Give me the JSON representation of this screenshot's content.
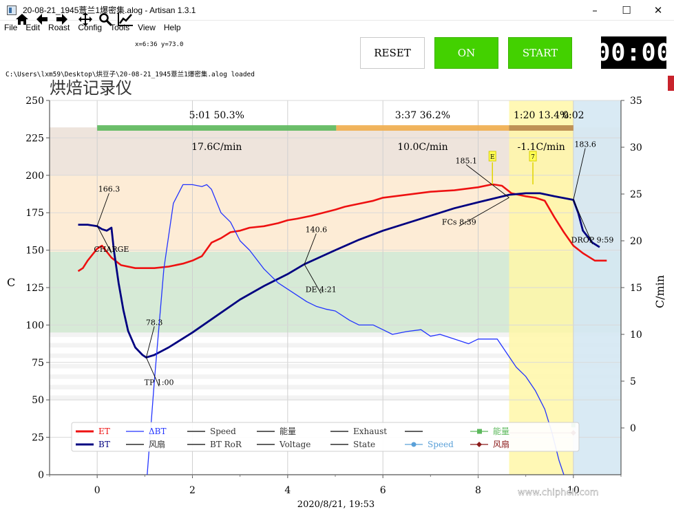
{
  "window": {
    "title": "20-08-21_1945薏兰1爆密集.alog - Artisan 1.3.1",
    "controls": [
      "–",
      "☐",
      "✕"
    ]
  },
  "menu": [
    "File",
    "Edit",
    "Roast",
    "Config",
    "Tools",
    "View",
    "Help"
  ],
  "toolbar": {
    "icons": [
      "home-icon",
      "back-arrow-icon",
      "forward-arrow-icon",
      "pan-icon",
      "zoom-icon",
      "chart-icon"
    ],
    "coordinate_readout": "x=6:36 y=73.0"
  },
  "buttons": {
    "reset": "RESET",
    "on": "ON",
    "start": "START"
  },
  "timer": "00:00",
  "status_message": "C:\\Users\\lxm59\\Desktop\\烘豆子\\20-08-21_1945薏兰1爆密集.alog  loaded",
  "colors": {
    "et": "#ee1111",
    "bt": "#000080",
    "delta_bt": "#2233ff",
    "phase_drying": "#5cb85c",
    "phase_maillard": "#f0ad4e",
    "phase_development": "#b8864b",
    "button_green": "#43d100"
  },
  "chart_data": {
    "type": "line",
    "title": "烘焙记录仪",
    "xlabel": "2020/8/21, 19:53",
    "ylabel": "C",
    "y2label": "C/min",
    "xlim": [
      -1,
      11
    ],
    "ylim": [
      0,
      250
    ],
    "y2lim": [
      -5,
      35
    ],
    "xticks": [
      0,
      2,
      4,
      6,
      8,
      10
    ],
    "yticks": [
      0,
      25,
      50,
      75,
      100,
      125,
      150,
      175,
      200,
      225,
      250
    ],
    "y2ticks": [
      0,
      5,
      10,
      15,
      20,
      25,
      30,
      35
    ],
    "grid": true,
    "phases": [
      {
        "time": "5:01",
        "pct": "50.3%",
        "ror": "17.6C/min",
        "start": 0,
        "end": 5.02
      },
      {
        "time": "3:37",
        "pct": "36.2%",
        "ror": "10.0C/min",
        "start": 5.02,
        "end": 8.65
      },
      {
        "time": "1:20",
        "pct": "13.4%",
        "ror": "-1.1C/min",
        "start": 8.65,
        "end": 10.0
      }
    ],
    "phase_extra_label": "0:02",
    "series": [
      {
        "name": "ET",
        "axis": "left",
        "points": [
          [
            -0.4,
            136
          ],
          [
            -0.3,
            138
          ],
          [
            -0.2,
            143
          ],
          [
            -0.1,
            147
          ],
          [
            0.0,
            151
          ],
          [
            0.1,
            153
          ],
          [
            0.3,
            145
          ],
          [
            0.5,
            140
          ],
          [
            0.8,
            138
          ],
          [
            1.2,
            138
          ],
          [
            1.5,
            139
          ],
          [
            1.8,
            141
          ],
          [
            2.0,
            143
          ],
          [
            2.2,
            146
          ],
          [
            2.4,
            155
          ],
          [
            2.6,
            158
          ],
          [
            2.8,
            162
          ],
          [
            3.0,
            163
          ],
          [
            3.2,
            165
          ],
          [
            3.5,
            166
          ],
          [
            3.8,
            168
          ],
          [
            4.0,
            170
          ],
          [
            4.2,
            171
          ],
          [
            4.5,
            173
          ],
          [
            5.0,
            177
          ],
          [
            5.2,
            179
          ],
          [
            5.5,
            181
          ],
          [
            5.8,
            183
          ],
          [
            6.0,
            185
          ],
          [
            6.5,
            187
          ],
          [
            7.0,
            189
          ],
          [
            7.5,
            190
          ],
          [
            8.0,
            192
          ],
          [
            8.3,
            194
          ],
          [
            8.5,
            193
          ],
          [
            8.7,
            188
          ],
          [
            9.0,
            186
          ],
          [
            9.2,
            185
          ],
          [
            9.4,
            183
          ],
          [
            9.6,
            172
          ],
          [
            9.8,
            162
          ],
          [
            10.0,
            153
          ],
          [
            10.2,
            148
          ],
          [
            10.3,
            146
          ],
          [
            10.45,
            143
          ],
          [
            10.7,
            143
          ]
        ]
      },
      {
        "name": "BT",
        "axis": "left",
        "points": [
          [
            -0.4,
            167
          ],
          [
            -0.2,
            167
          ],
          [
            0.0,
            166
          ],
          [
            0.1,
            164
          ],
          [
            0.2,
            163
          ],
          [
            0.3,
            165
          ],
          [
            0.35,
            150
          ],
          [
            0.45,
            128
          ],
          [
            0.55,
            110
          ],
          [
            0.65,
            96
          ],
          [
            0.8,
            85
          ],
          [
            0.95,
            80
          ],
          [
            1.03,
            78.3
          ],
          [
            1.2,
            80
          ],
          [
            1.5,
            85
          ],
          [
            2.0,
            95
          ],
          [
            2.5,
            106
          ],
          [
            3.0,
            117
          ],
          [
            3.5,
            126
          ],
          [
            4.0,
            134
          ],
          [
            4.35,
            140.6
          ],
          [
            5.0,
            150
          ],
          [
            5.5,
            157
          ],
          [
            6.0,
            163
          ],
          [
            6.5,
            168
          ],
          [
            7.0,
            173
          ],
          [
            7.5,
            178
          ],
          [
            8.0,
            182
          ],
          [
            8.65,
            187
          ],
          [
            9.0,
            188
          ],
          [
            9.3,
            188
          ],
          [
            9.6,
            186
          ],
          [
            10.0,
            183.6
          ],
          [
            10.1,
            175
          ],
          [
            10.2,
            163
          ],
          [
            10.4,
            155
          ],
          [
            10.55,
            152
          ]
        ]
      },
      {
        "name": "ΔBT",
        "axis": "right",
        "points": [
          [
            1.05,
            -5
          ],
          [
            1.2,
            5
          ],
          [
            1.4,
            17
          ],
          [
            1.6,
            24
          ],
          [
            1.8,
            26
          ],
          [
            2.0,
            26
          ],
          [
            2.2,
            25.8
          ],
          [
            2.3,
            26
          ],
          [
            2.4,
            25.5
          ],
          [
            2.6,
            23
          ],
          [
            2.8,
            22
          ],
          [
            3.0,
            20
          ],
          [
            3.2,
            19
          ],
          [
            3.5,
            17
          ],
          [
            3.8,
            15.5
          ],
          [
            4.1,
            14.5
          ],
          [
            4.4,
            13.5
          ],
          [
            4.6,
            13
          ],
          [
            4.8,
            12.7
          ],
          [
            5.0,
            12.5
          ],
          [
            5.3,
            11.5
          ],
          [
            5.5,
            11
          ],
          [
            5.8,
            11
          ],
          [
            6.0,
            10.5
          ],
          [
            6.2,
            10
          ],
          [
            6.5,
            10.3
          ],
          [
            6.8,
            10.5
          ],
          [
            7.0,
            9.8
          ],
          [
            7.2,
            10
          ],
          [
            7.5,
            9.5
          ],
          [
            7.8,
            9
          ],
          [
            8.0,
            9.5
          ],
          [
            8.2,
            9.5
          ],
          [
            8.4,
            9.5
          ],
          [
            8.6,
            8
          ],
          [
            8.8,
            6.5
          ],
          [
            9.0,
            5.5
          ],
          [
            9.2,
            4
          ],
          [
            9.4,
            2
          ],
          [
            9.55,
            -0.5
          ],
          [
            9.7,
            -3.5
          ],
          [
            9.8,
            -5
          ]
        ]
      }
    ],
    "annotations": [
      {
        "text": "166.3",
        "x": 0.0,
        "y": 166.3,
        "label_x": 0.25,
        "label_y": 189
      },
      {
        "text": "CHARGE",
        "x": 0.0,
        "y": 166.3,
        "label_x": 0.3,
        "label_y": 149
      },
      {
        "text": "78.3",
        "x": 1.03,
        "y": 78.3,
        "label_x": 1.2,
        "label_y": 100
      },
      {
        "text": "TP 1:00",
        "x": 1.03,
        "y": 78.3,
        "label_x": 1.3,
        "label_y": 60
      },
      {
        "text": "140.6",
        "x": 4.35,
        "y": 140.6,
        "label_x": 4.6,
        "label_y": 162
      },
      {
        "text": "DE 4:21",
        "x": 4.35,
        "y": 140.6,
        "label_x": 4.7,
        "label_y": 122
      },
      {
        "text": "185.1",
        "x": 8.65,
        "y": 185.1,
        "label_x": 7.75,
        "label_y": 208
      },
      {
        "text": "FCs 8:39",
        "x": 8.65,
        "y": 185.1,
        "label_x": 7.6,
        "label_y": 167
      },
      {
        "text": "183.6",
        "x": 10.0,
        "y": 183.6,
        "label_x": 10.25,
        "label_y": 219
      },
      {
        "text": "DROP 9:59",
        "x": 10.0,
        "y": 183.6,
        "label_x": 10.4,
        "label_y": 155
      }
    ],
    "event_flags": [
      {
        "text": "E",
        "x": 8.3
      },
      {
        "text": "7",
        "x": 9.15
      }
    ],
    "legend": [
      {
        "name": "ET",
        "color": "#ee1111",
        "kind": "line"
      },
      {
        "name": "ΔBT",
        "color": "#2233ff",
        "kind": "line"
      },
      {
        "name": "Speed",
        "color": "#000000",
        "kind": "line"
      },
      {
        "name": "能量",
        "color": "#000000",
        "kind": "line"
      },
      {
        "name": "Exhaust",
        "color": "#000000",
        "kind": "line"
      },
      {
        "name": "",
        "color": "#000000",
        "kind": "line"
      },
      {
        "name": "能量",
        "color": "#5cb85c",
        "kind": "square"
      },
      {
        "name": "BT",
        "color": "#000080",
        "kind": "line"
      },
      {
        "name": "风扇",
        "color": "#000000",
        "kind": "line"
      },
      {
        "name": "BT RoR",
        "color": "#000000",
        "kind": "line"
      },
      {
        "name": "Voltage",
        "color": "#000000",
        "kind": "line"
      },
      {
        "name": "State",
        "color": "#000000",
        "kind": "line"
      },
      {
        "name": "Speed",
        "color": "#5aa0d8",
        "kind": "dot"
      },
      {
        "name": "风扇",
        "color": "#8b1a1a",
        "kind": "diamond"
      }
    ],
    "legend_placement": "bottom-center"
  },
  "watermark": "www.chiphell.com"
}
